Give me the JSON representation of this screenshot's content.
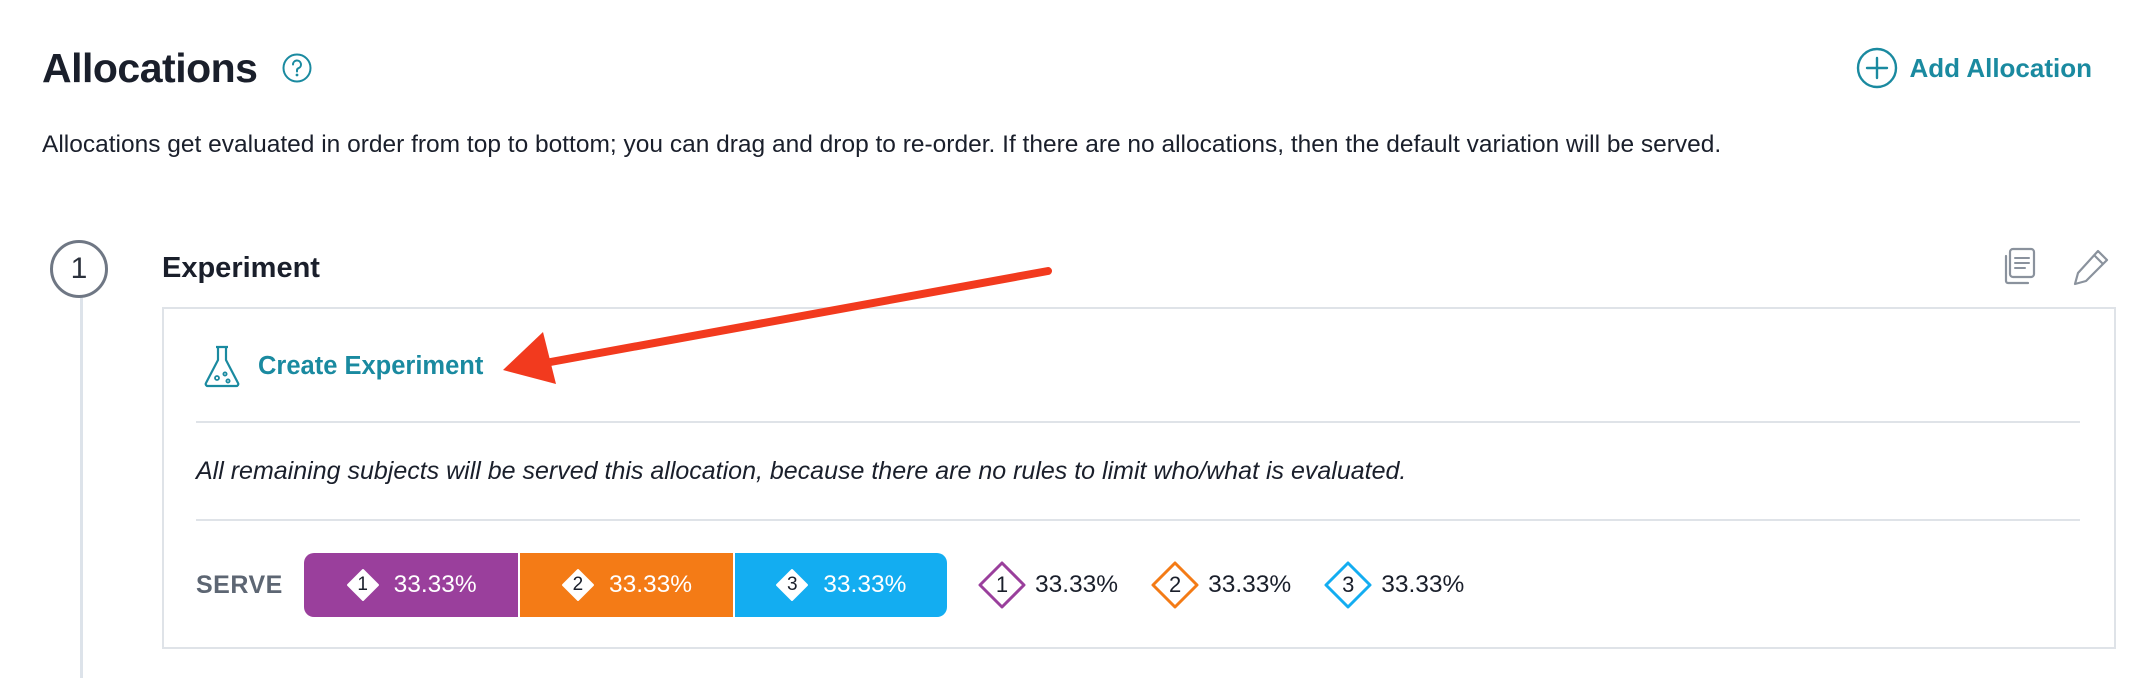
{
  "header": {
    "title": "Allocations",
    "help_icon": "question-circle-icon",
    "add_allocation_label": "Add Allocation",
    "add_allocation_icon": "plus-circle-icon"
  },
  "description": "Allocations get evaluated in order from top to bottom; you can drag and drop to re-order. If there are no allocations, then the default variation will be served.",
  "allocations": [
    {
      "step_number": "1",
      "name": "Experiment",
      "actions": [
        "copy-icon",
        "edit-pencil-icon"
      ],
      "create_experiment_label": "Create Experiment",
      "create_experiment_icon": "flask-icon",
      "rule_text": "All remaining subjects will be served this allocation, because there are no rules to limit who/what is evaluated.",
      "serve_label": "SERVE",
      "variations": [
        {
          "key": "1",
          "share_percent": 33.33,
          "percent_label": "33.33%",
          "color": "#9a3f9c"
        },
        {
          "key": "2",
          "share_percent": 33.33,
          "percent_label": "33.33%",
          "color": "#f47b16"
        },
        {
          "key": "3",
          "share_percent": 33.33,
          "percent_label": "33.33%",
          "color": "#13adf1"
        }
      ]
    }
  ],
  "colors": {
    "accent": "#1a8aa0",
    "annotation_arrow": "#f23a1e"
  }
}
